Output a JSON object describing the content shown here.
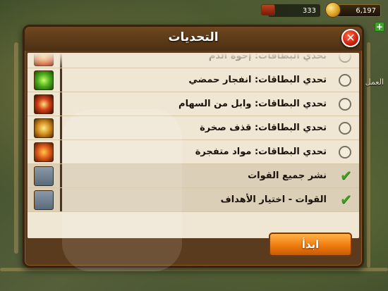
{
  "hud": {
    "troops_count": "333",
    "gold_count": "6,197",
    "side_label": "العمل"
  },
  "dialog": {
    "title": "التحديات",
    "close_label": "✕",
    "start_label": "ابدأ"
  },
  "challenges": [
    {
      "label": "تحدي البطاقات: إخوة الدم",
      "state": "unchecked",
      "thumb": "fire"
    },
    {
      "label": "تحدي البطاقات: انفجار حمضي",
      "state": "unchecked",
      "thumb": "green"
    },
    {
      "label": "تحدي البطاقات: وابل من السهام",
      "state": "unchecked",
      "thumb": "arrows"
    },
    {
      "label": "تحدي البطاقات: قذف صخرة",
      "state": "unchecked",
      "thumb": "rock"
    },
    {
      "label": "تحدي البطاقات: مواد متفجرة",
      "state": "unchecked",
      "thumb": "blast"
    },
    {
      "label": "نشر جميع القوات",
      "state": "checked",
      "thumb": "troop"
    },
    {
      "label": "القوات - اختيار الأهداف",
      "state": "checked",
      "thumb": "troop"
    }
  ],
  "colors": {
    "check": "#3da21a",
    "start_button": "#f07c10",
    "close_button": "#d0200a"
  }
}
